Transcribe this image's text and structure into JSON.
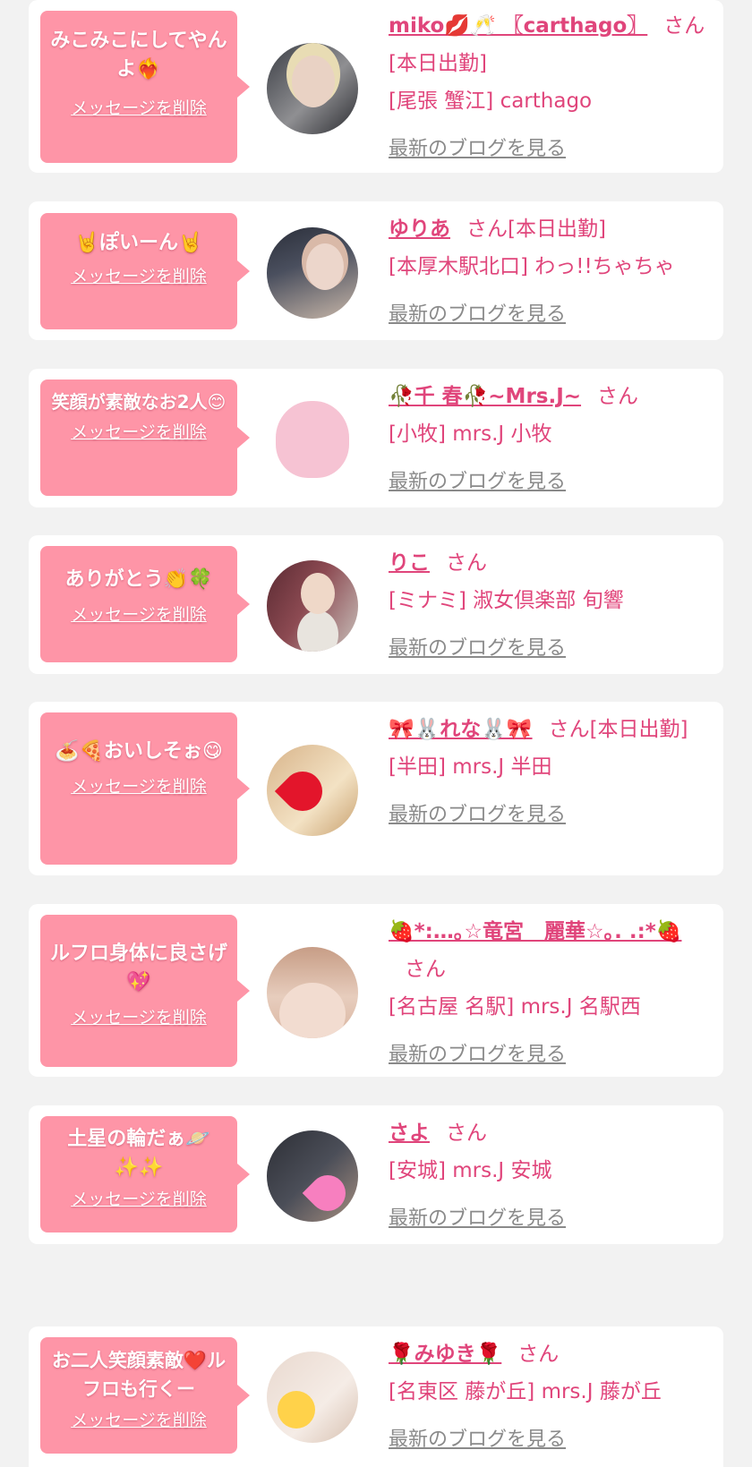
{
  "delete_label": "メッセージを削除",
  "blog_label": "最新のブログを見る",
  "colors": {
    "accent": "#e0457b",
    "bubble": "#fe95a7",
    "link_gray": "#8a8a8a",
    "background": "#f2f2f2"
  },
  "entries": [
    {
      "message": "みこみこにしてやんよ❤️‍🔥",
      "name": "miko💋🥂 〖carthago〗",
      "status": "さん[本日出勤]",
      "shop": "[尾張 蟹江] carthago"
    },
    {
      "message": "🤘ぽいーん🤘",
      "name": "ゆりあ",
      "status": "さん[本日出勤]",
      "shop": "[本厚木駅北口] わっ!!ちゃちゃ"
    },
    {
      "message": "笑顔が素敵なお2人😊",
      "name": "🥀千 春🥀~Mrs.J~",
      "status": "さん",
      "shop": "[小牧] mrs.J 小牧"
    },
    {
      "message": "ありがとう👏🍀",
      "name": "りこ",
      "status": "さん",
      "shop": "[ミナミ] 淑女倶楽部 旬響"
    },
    {
      "message": "🍝🍕おいしそぉ😋",
      "name": "🎀🐰れな🐰🎀",
      "status": "さん[本日出勤]",
      "shop": "[半田] mrs.J 半田"
    },
    {
      "message": "ルフロ身体に良さげ💖",
      "name": "🍓*:…｡☆竜宮　麗華☆｡. .:*🍓",
      "status": "さん",
      "shop": "[名古屋 名駅] mrs.J 名駅西"
    },
    {
      "message": "土星の輪だぁ🪐✨✨",
      "name": "さよ",
      "status": "さん",
      "shop": "[安城] mrs.J 安城"
    },
    {
      "message": "お二人笑顔素敵❤️ルフロも行くー",
      "name": "🌹みゆき🌹",
      "status": "さん",
      "shop": "[名東区 藤が丘] mrs.J 藤が丘"
    }
  ]
}
